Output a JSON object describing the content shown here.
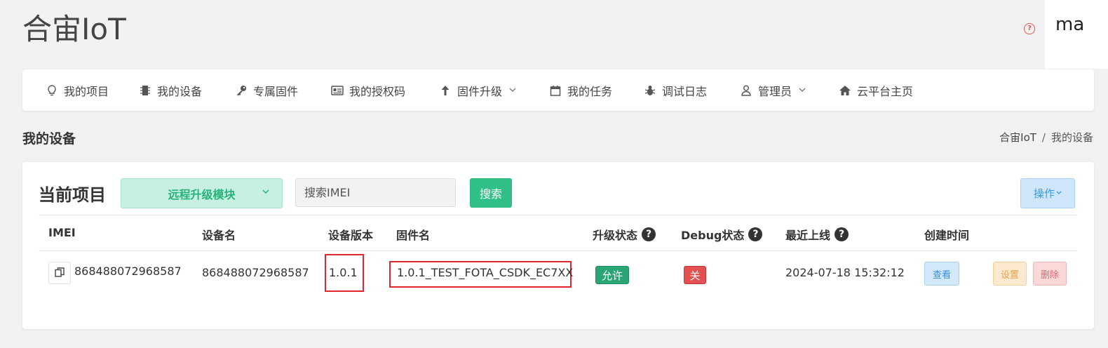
{
  "header": {
    "brand": "合宙IoT",
    "user": "ma",
    "help_icon": "question-circle-icon",
    "help_glyph": "?"
  },
  "nav": {
    "items": [
      {
        "label": "我的项目",
        "icon": "lightbulb-icon"
      },
      {
        "label": "我的设备",
        "icon": "chip-icon"
      },
      {
        "label": "专属固件",
        "icon": "key-icon"
      },
      {
        "label": "我的授权码",
        "icon": "id-card-icon"
      },
      {
        "label": "固件升级",
        "icon": "arrow-up-icon",
        "dropdown": true
      },
      {
        "label": "我的任务",
        "icon": "calendar-icon"
      },
      {
        "label": "调试日志",
        "icon": "bug-icon"
      },
      {
        "label": "管理员",
        "icon": "user-icon",
        "dropdown": true
      },
      {
        "label": "云平台主页",
        "icon": "home-icon"
      }
    ]
  },
  "page": {
    "title": "我的设备",
    "breadcrumb": {
      "root": "合宙IoT",
      "separator": "/",
      "current": "我的设备"
    }
  },
  "toolbar": {
    "project_label": "当前项目",
    "project_value": "远程升级模块",
    "search_placeholder": "搜索IMEI",
    "search_button": "搜索",
    "ops_button": "操作"
  },
  "table": {
    "headers": [
      "IMEI",
      "设备名",
      "设备版本",
      "固件名",
      "升级状态",
      "Debug状态",
      "最近上线",
      "创建时间"
    ],
    "help_glyph": "?",
    "rows": [
      {
        "imei": "868488072968587",
        "device_name": "868488072968587",
        "version": "1.0.1",
        "firmware": "1.0.1_TEST_FOTA_CSDK_EC7XX",
        "upgrade_status": "允许",
        "debug_status": "关",
        "last_online": "2024-07-18 15:32:12",
        "actions": {
          "view": "查看",
          "settings": "设置",
          "delete": "删除"
        }
      }
    ]
  },
  "colors": {
    "accent_green": "#2fbf87",
    "highlight_red": "#e0262b",
    "ops_blue": "#3a9ae6"
  }
}
